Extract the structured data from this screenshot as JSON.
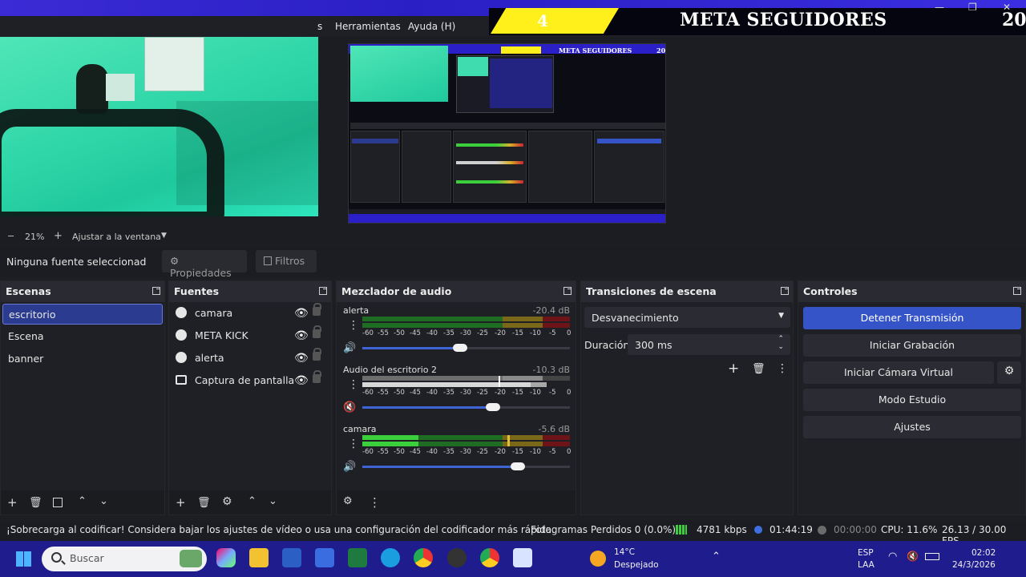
{
  "window": {
    "minimize": "—",
    "restore": "❐",
    "close": "✕"
  },
  "menu": {
    "items": [
      "s",
      "Herramientas",
      "Ayuda (H)"
    ]
  },
  "banner": {
    "number": "4",
    "title": "META SEGUIDORES",
    "count": "20"
  },
  "nested_preview": {
    "title": "META SEGUIDORES",
    "count": "20"
  },
  "zoom": {
    "minus": "−",
    "value": "21%",
    "plus": "+",
    "fit": "Ajustar a la ventana",
    "chevron": "▼"
  },
  "source_bar": {
    "no_source": "Ninguna fuente seleccionad",
    "properties": "Propiedades",
    "filters": "Filtros"
  },
  "scenes": {
    "title": "Escenas",
    "items": [
      "escritorio",
      "Escena",
      "banner"
    ],
    "selected": "escritorio"
  },
  "sources": {
    "title": "Fuentes",
    "items": [
      {
        "label": "camara",
        "icon": "globe-icon"
      },
      {
        "label": "META KICK",
        "icon": "globe-icon"
      },
      {
        "label": "alerta",
        "icon": "globe-icon"
      },
      {
        "label": "Captura de pantalla",
        "icon": "monitor-icon"
      }
    ]
  },
  "mixer": {
    "title": "Mezclador de audio",
    "scale": [
      "-60",
      "-55",
      "-50",
      "-45",
      "-40",
      "-35",
      "-30",
      "-25",
      "-20",
      "-15",
      "-10",
      "-5",
      "0"
    ],
    "channels": [
      {
        "name": "alerta",
        "db": "-20.4 dB",
        "volume": 0.47,
        "muted": false
      },
      {
        "name": "Audio del escritorio 2",
        "db": "-10.3 dB",
        "volume": 0.63,
        "muted": true
      },
      {
        "name": "camara",
        "db": "-5.6 dB",
        "volume": 0.75,
        "muted": false
      }
    ]
  },
  "transitions": {
    "title": "Transiciones de escena",
    "selected": "Desvanecimiento",
    "duration_label": "Duración",
    "duration_value": "300 ms"
  },
  "controls": {
    "title": "Controles",
    "stop_stream": "Detener Transmisión",
    "start_recording": "Iniciar Grabación",
    "start_virtual_cam": "Iniciar Cámara Virtual",
    "studio_mode": "Modo Estudio",
    "settings": "Ajustes"
  },
  "status": {
    "warning": "¡Sobrecarga al codificar! Considera bajar los ajustes de vídeo o usa una configuración del codificador más rápida.",
    "dropped": "Fotogramas Perdidos 0 (0.0%)",
    "bitrate": "4781 kbps",
    "live_time": "01:44:19",
    "rec_time": "00:00:00",
    "cpu": "CPU: 11.6%",
    "fps": "26.13 / 30.00 FPS"
  },
  "taskbar": {
    "search_placeholder": "Buscar",
    "weather_temp": "14°C",
    "weather_desc": "Despejado",
    "lang1": "ESP",
    "lang2": "LAA",
    "time": "02:02",
    "date": "24/3/2026",
    "colors": {
      "bar": "#1f1d8d"
    }
  },
  "colors": {
    "accent": "#3554c7",
    "selection": "#2b3b8f",
    "meter_green": "#3ccf3c",
    "meter_yellow": "#d6b22a",
    "meter_red": "#c8242e"
  }
}
